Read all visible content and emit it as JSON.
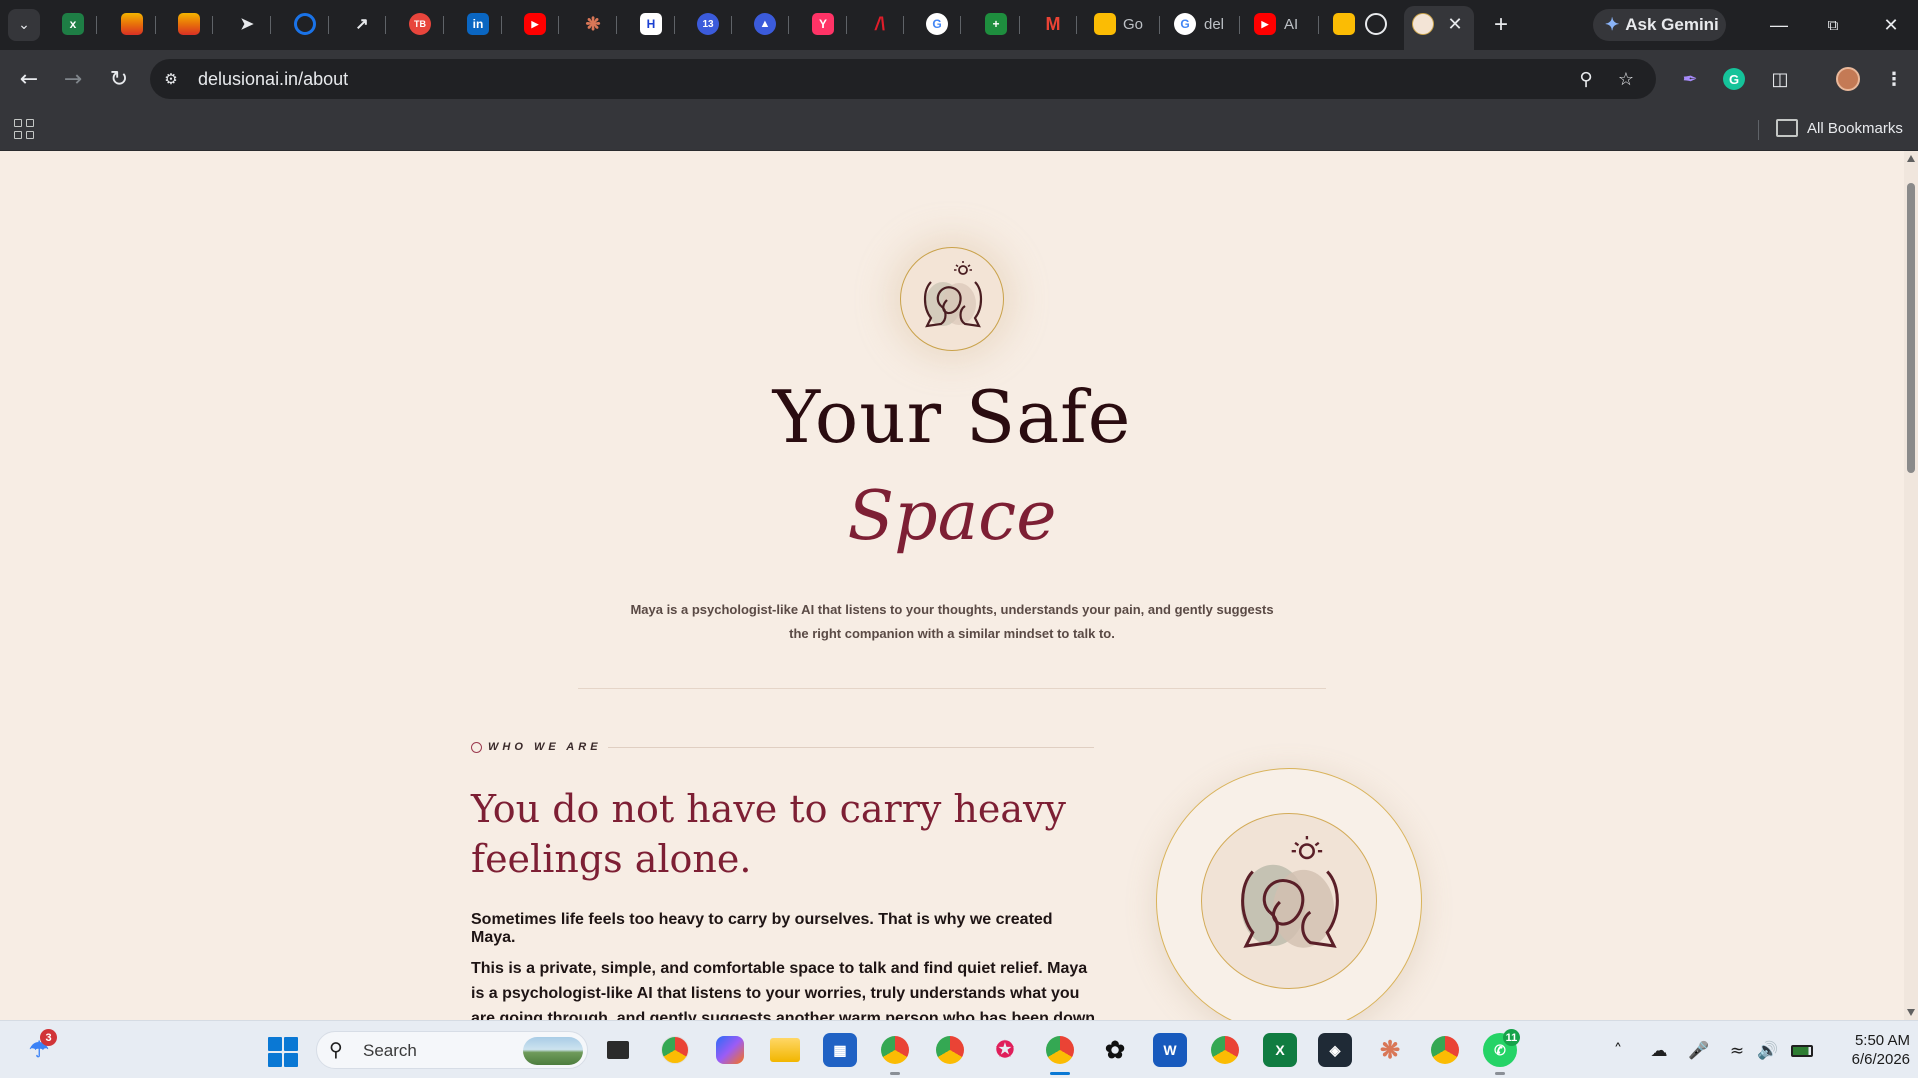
{
  "browser": {
    "tabs": [
      {
        "label": "Go",
        "favicon": "meet-icon"
      },
      {
        "label": "del",
        "favicon": "google-icon"
      },
      {
        "label": "AI ",
        "favicon": "youtube-icon"
      }
    ],
    "ask_gemini_label": "Ask Gemini",
    "url": "delusionai.in/about",
    "bookmarks_label": "All Bookmarks"
  },
  "page": {
    "hero": {
      "title_line1": "Your Safe",
      "title_line2": "Space",
      "description": "Maya is a psychologist-like AI that listens to your thoughts, understands your pain, and gently suggests the right companion with a similar mindset to talk to."
    },
    "about": {
      "eyebrow": "WHO WE ARE",
      "heading": "You do not have to carry heavy feelings alone.",
      "paragraph1": "Sometimes life feels too heavy to carry by ourselves. That is why we created Maya.",
      "paragraph2": "This is a private, simple, and comfortable space to talk and find quiet relief. Maya is a psychologist-like AI that listens to your worries, truly understands what you are going through, and gently suggests another warm person who has been down the same path"
    },
    "colors": {
      "background": "#f7ede4",
      "title": "#2a0c10",
      "accent": "#7d1f34",
      "gold": "#c9a24a"
    }
  },
  "taskbar": {
    "search_label": "Search",
    "weather_badge": "3",
    "whatsapp_badge": "11",
    "time": "5:50 AM",
    "date": "6/6/2026"
  }
}
